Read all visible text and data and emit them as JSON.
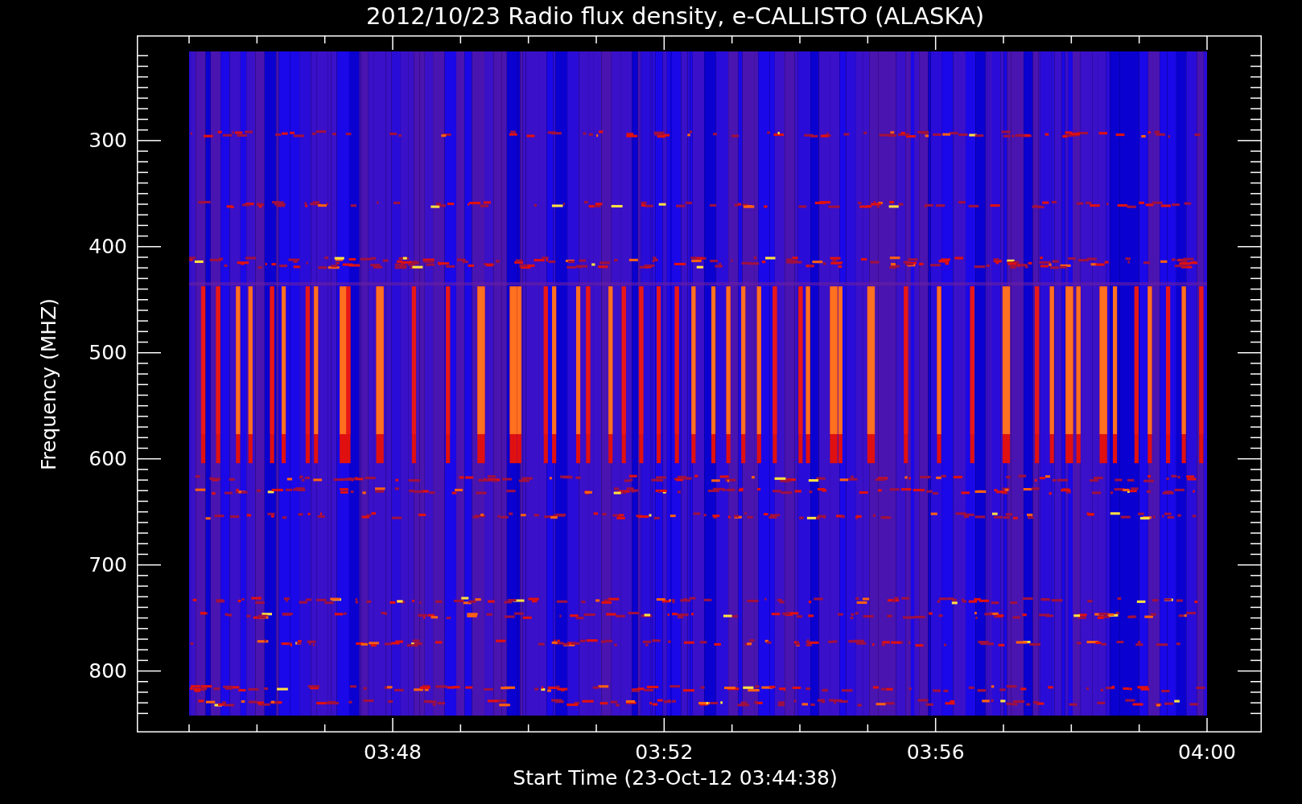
{
  "title": "2012/10/23  Radio flux density, e-CALLISTO (ALASKA)",
  "y_axis": {
    "title": "Frequency (MHZ)",
    "ticks": [
      "300",
      "400",
      "500",
      "600",
      "700",
      "800"
    ]
  },
  "x_axis": {
    "title": "Start Time (23-Oct-12 03:44:38)",
    "ticks": [
      "03:48",
      "03:52",
      "03:56",
      "04:00"
    ]
  }
}
